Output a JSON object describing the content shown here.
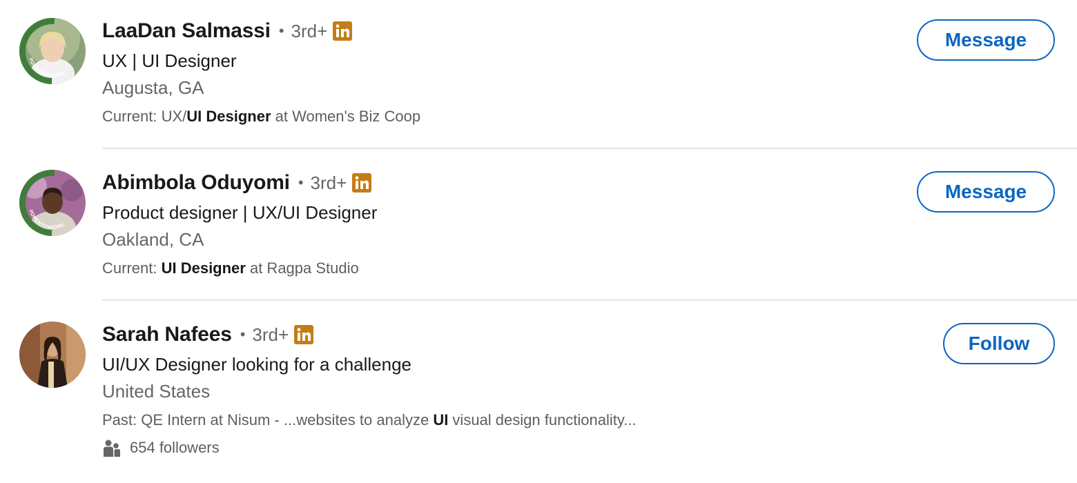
{
  "results": [
    {
      "name": "LaaDan Salmassi",
      "degree": "3rd+",
      "separator": "•",
      "headline": "UX | UI Designer",
      "location": "Augusta, GA",
      "snippet": {
        "prefix": "Current: UX/",
        "bold": "UI Designer",
        "suffix": " at Women's Biz Coop"
      },
      "action": "Message",
      "badge_icon": "linkedin-icon",
      "avatar_ring": "#OPENTOWORK"
    },
    {
      "name": "Abimbola Oduyomi",
      "degree": "3rd+",
      "separator": "•",
      "headline": "Product designer | UX/UI Designer",
      "location": "Oakland, CA",
      "snippet": {
        "prefix": "Current: ",
        "bold": "UI Designer",
        "suffix": " at Ragpa Studio"
      },
      "action": "Message",
      "badge_icon": "linkedin-icon",
      "avatar_ring": "#OPENTOWORK"
    },
    {
      "name": "Sarah Nafees",
      "degree": "3rd+",
      "separator": "•",
      "headline": "UI/UX Designer looking for a challenge",
      "location": "United States",
      "snippet": {
        "prefix": "Past: QE Intern at Nisum - ...websites to analyze ",
        "bold": "UI",
        "suffix": " visual design functionality..."
      },
      "followers": "654 followers",
      "action": "Follow",
      "badge_icon": "linkedin-icon"
    }
  ],
  "colors": {
    "accent": "#0a66c2",
    "linkedin_badge": "#c37d16",
    "open_to_work_green": "#3f7e3a",
    "secondary_text": "#666666",
    "divider": "#e5e5e5"
  }
}
